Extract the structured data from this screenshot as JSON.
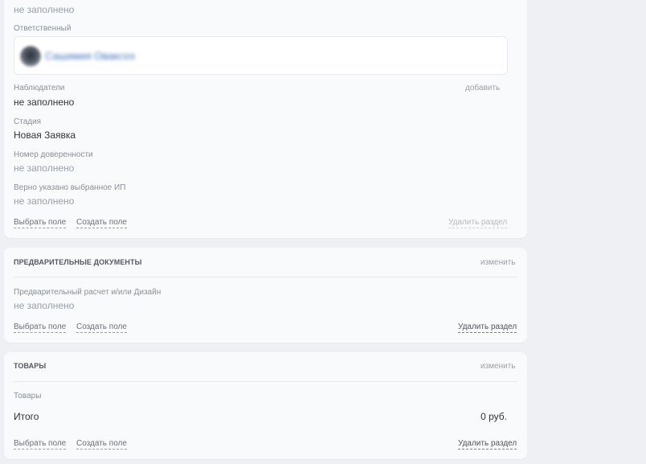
{
  "card1": {
    "top_value": "не заполнено",
    "responsible": {
      "label": "Ответственный",
      "name": "Сашимия Оваксоэ"
    },
    "observers": {
      "label": "Наблюдатели",
      "value": "не заполнено",
      "add_label": "добавить"
    },
    "stage": {
      "label": "Стадия",
      "value": "Новая Заявка"
    },
    "poa_number": {
      "label": "Номер доверенности",
      "value": "не заполнено"
    },
    "ip_correct": {
      "label": "Верно указано выбранное ИП",
      "value": "не заполнено"
    },
    "select_field": "Выбрать поле",
    "create_field": "Создать поле",
    "delete_section": "Удалить раздел"
  },
  "card2": {
    "title": "ПРЕДВАРИТЕЛЬНЫЕ ДОКУМЕНТЫ",
    "edit_label": "изменить",
    "field": {
      "label": "Предварительный расчет и/или Дизайн",
      "value": "не заполнено"
    },
    "select_field": "Выбрать поле",
    "create_field": "Создать поле",
    "delete_section": "Удалить раздел"
  },
  "card3": {
    "title": "ТОВАРЫ",
    "edit_label": "изменить",
    "products_label": "Товары",
    "total_label": "Итого",
    "total_value": "0 руб.",
    "select_field": "Выбрать поле",
    "create_field": "Создать поле",
    "delete_section": "Удалить раздел"
  }
}
